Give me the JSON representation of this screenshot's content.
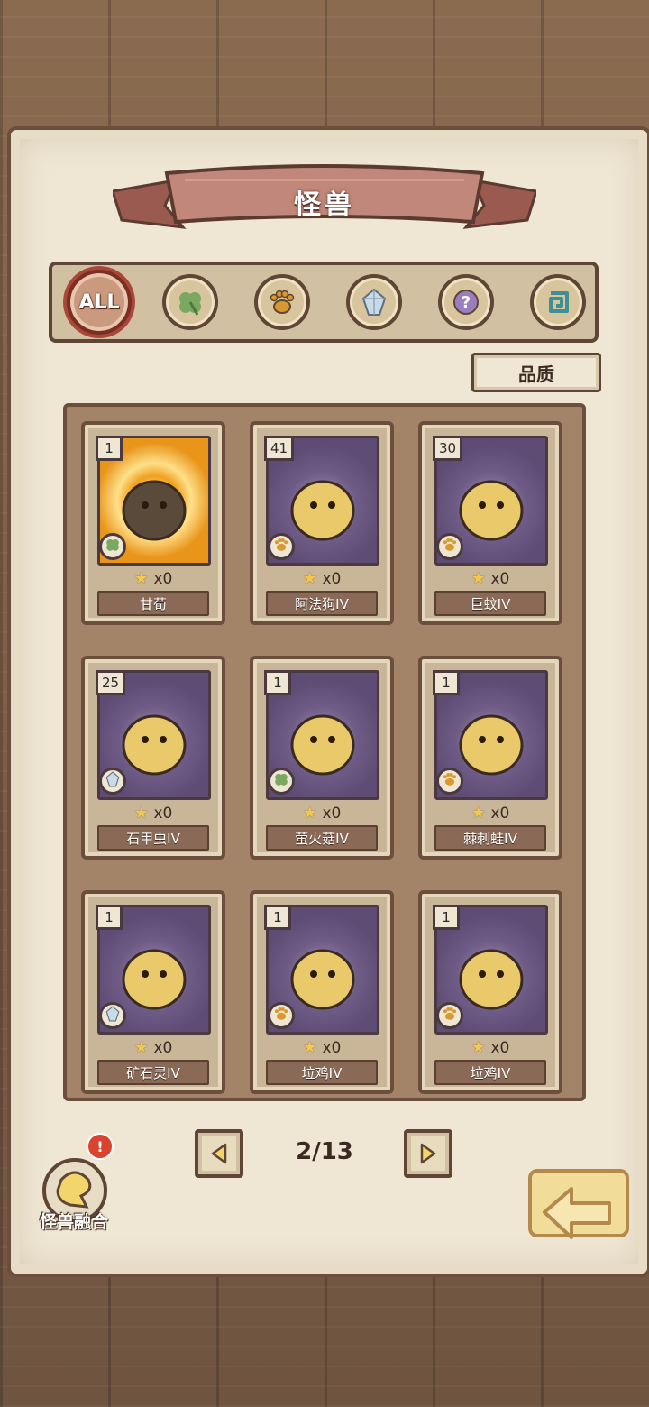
{
  "screen": {
    "title": "怪兽",
    "quality_label": "品质",
    "filters": [
      {
        "id": "all",
        "label": "ALL",
        "icon": "all-icon",
        "active": true
      },
      {
        "id": "plant",
        "icon": "clover-icon",
        "active": false
      },
      {
        "id": "beast",
        "icon": "paw-icon",
        "active": false
      },
      {
        "id": "mineral",
        "icon": "crystal-icon",
        "active": false
      },
      {
        "id": "unknown",
        "icon": "question-icon",
        "active": false
      },
      {
        "id": "special",
        "icon": "spiral-icon",
        "active": false
      }
    ],
    "pagination": {
      "text": "2/13",
      "prev_icon": "arrow-left-icon",
      "next_icon": "arrow-right-icon"
    },
    "fusion": {
      "label": "怪兽融合",
      "alert": "!"
    },
    "back_icon": "back-arrow-icon"
  },
  "cards": [
    {
      "level": "1",
      "count": "x0",
      "name": "甘荀",
      "type_icon": "clover-icon",
      "art": "gold"
    },
    {
      "level": "41",
      "count": "x0",
      "name": "阿法狗IV",
      "type_icon": "paw-icon",
      "art": "purple"
    },
    {
      "level": "30",
      "count": "x0",
      "name": "巨蚊IV",
      "type_icon": "paw-icon",
      "art": "purple"
    },
    {
      "level": "25",
      "count": "x0",
      "name": "石甲虫IV",
      "type_icon": "crystal-icon",
      "art": "purple"
    },
    {
      "level": "1",
      "count": "x0",
      "name": "萤火菇IV",
      "type_icon": "clover-icon",
      "art": "purple"
    },
    {
      "level": "1",
      "count": "x0",
      "name": "棘刺蛙IV",
      "type_icon": "paw-icon",
      "art": "purple"
    },
    {
      "level": "1",
      "count": "x0",
      "name": "矿石灵IV",
      "type_icon": "crystal-icon",
      "art": "purple"
    },
    {
      "level": "1",
      "count": "x0",
      "name": "垃鸡IV",
      "type_icon": "paw-icon",
      "art": "purple"
    },
    {
      "level": "1",
      "count": "x0",
      "name": "垃鸡IV",
      "type_icon": "paw-icon",
      "art": "purple"
    }
  ]
}
